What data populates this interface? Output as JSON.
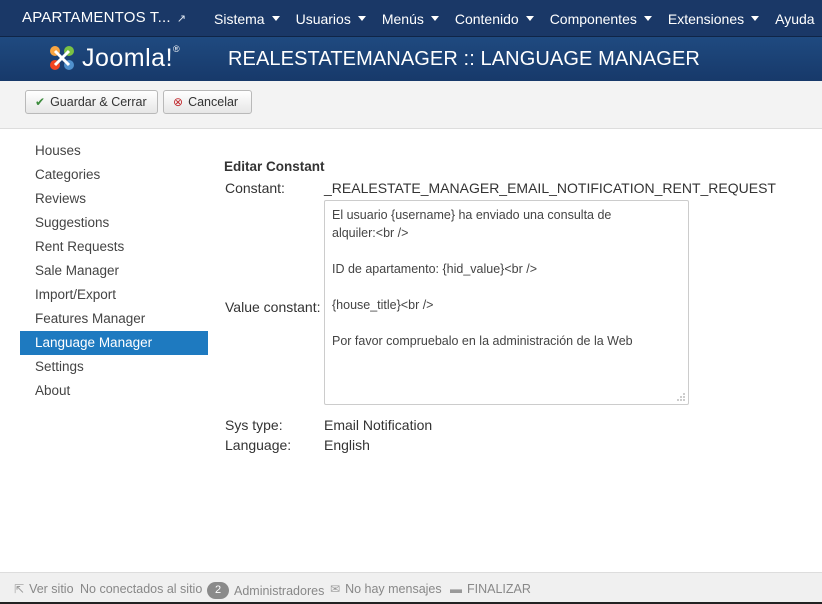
{
  "topnav": {
    "site_title": "APARTAMENTOS T...",
    "external_icon": "external-link-icon",
    "menu": [
      {
        "label": "Sistema"
      },
      {
        "label": "Usuarios"
      },
      {
        "label": "Menús"
      },
      {
        "label": "Contenido"
      },
      {
        "label": "Componentes"
      },
      {
        "label": "Extensiones"
      },
      {
        "label": "Ayuda"
      }
    ]
  },
  "header": {
    "logo_text": "Joomla!",
    "logo_mark": "®",
    "page_title": "REALESTATEMANAGER :: LANGUAGE MANAGER"
  },
  "toolbar": {
    "save_label": "Guardar & Cerrar",
    "save_icon": "check-icon",
    "cancel_label": "Cancelar",
    "cancel_icon": "cancel-circle-icon"
  },
  "sidebar": {
    "items": [
      {
        "label": "Houses"
      },
      {
        "label": "Categories"
      },
      {
        "label": "Reviews"
      },
      {
        "label": "Suggestions"
      },
      {
        "label": "Rent Requests"
      },
      {
        "label": "Sale Manager"
      },
      {
        "label": "Import/Export"
      },
      {
        "label": "Features Manager"
      },
      {
        "label": "Language Manager",
        "active": true
      },
      {
        "label": "Settings"
      },
      {
        "label": "About"
      }
    ]
  },
  "form": {
    "title": "Editar Constant",
    "constant_label": "Constant:",
    "constant_value": "_REALESTATE_MANAGER_EMAIL_NOTIFICATION_RENT_REQUEST",
    "value_label": "Value constant:",
    "value_lines": [
      "El usuario {username} ha enviado una consulta de",
      "alquiler:<br />",
      "",
      "ID de apartamento: {hid_value}<br />",
      "",
      "{house_title}<br />",
      "",
      "Por favor compruebalo en la administración de la Web"
    ],
    "systype_label": "Sys type:",
    "systype_value": "Email Notification",
    "language_label": "Language:",
    "language_value": "English"
  },
  "footer": {
    "view_site": "Ver sitio",
    "not_connected": "No conectados al sitio",
    "admins_count": "2",
    "admins_label": "Administradores",
    "messages": "No hay mensajes",
    "logout": "FINALIZAR"
  },
  "colors": {
    "nav_bg": "#1a3867",
    "header_bg": "#1f4a80",
    "active_item": "#1e7ac0"
  }
}
